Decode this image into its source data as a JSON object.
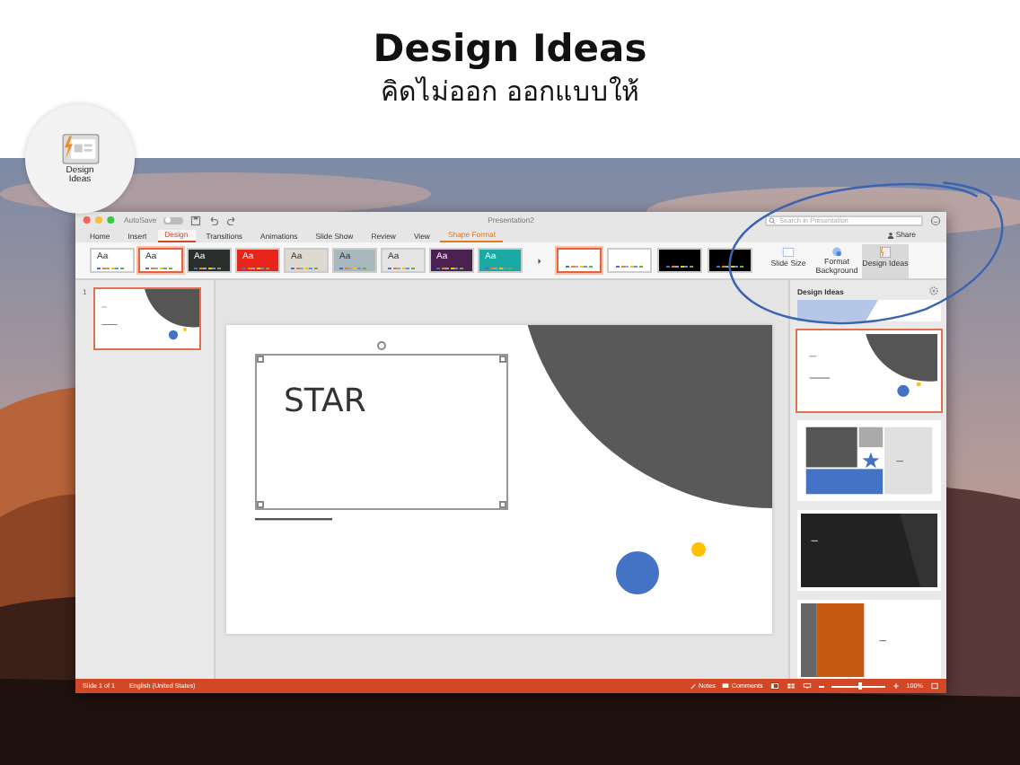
{
  "header": {
    "title": "Design Ideas",
    "subtitle": "คิดไม่ออก ออกแบบให้"
  },
  "badge": {
    "label": "Design Ideas"
  },
  "window": {
    "title": "Presentation2",
    "autosave": "AutoSave",
    "autosave_on": false,
    "search": {
      "placeholder": "Search in Presentation"
    }
  },
  "tabs": [
    {
      "label": "Home",
      "selected": false,
      "kind": "standard"
    },
    {
      "label": "Insert",
      "selected": false,
      "kind": "standard"
    },
    {
      "label": "Design",
      "selected": true,
      "kind": "standard"
    },
    {
      "label": "Transitions",
      "selected": false,
      "kind": "standard"
    },
    {
      "label": "Animations",
      "selected": false,
      "kind": "standard"
    },
    {
      "label": "Slide Show",
      "selected": false,
      "kind": "standard"
    },
    {
      "label": "Review",
      "selected": false,
      "kind": "standard"
    },
    {
      "label": "View",
      "selected": false,
      "kind": "standard"
    },
    {
      "label": "Shape Format",
      "selected": false,
      "kind": "contextual"
    }
  ],
  "share": "Share",
  "themes": [
    {
      "label": "Aa",
      "color": "#ffffff",
      "selected": false
    },
    {
      "label": "Aa",
      "color": "#ffffff",
      "selected": true
    },
    {
      "label": "Aa",
      "color": "#2b2f2c",
      "selected": false
    },
    {
      "label": "Aa",
      "color": "#e8251b",
      "selected": false
    },
    {
      "label": "Aa",
      "color": "#dedad2",
      "selected": false
    },
    {
      "label": "Aa",
      "color": "#a9b8bf",
      "selected": false
    },
    {
      "label": "Aa",
      "color": "#e4e4e4",
      "selected": false
    },
    {
      "label": "Aa",
      "color": "#4a2150",
      "selected": false
    },
    {
      "label": "Aa",
      "color": "#1aa9a3",
      "selected": false
    }
  ],
  "variants": [
    {
      "color": "#ffffff",
      "selected": true
    },
    {
      "color": "#ffffff",
      "selected": false
    },
    {
      "color": "#000000",
      "selected": false
    },
    {
      "color": "#000000",
      "selected": false
    }
  ],
  "ribbon_buttons": [
    {
      "label": "Slide Size",
      "kind": "size",
      "selected": false
    },
    {
      "label": "Format Background",
      "kind": "background",
      "selected": false
    },
    {
      "label": "Design Ideas",
      "kind": "ideas",
      "selected": true
    }
  ],
  "slides_panel": {
    "number": "1"
  },
  "slide": {
    "text": "STAR"
  },
  "design_ideas": {
    "title": "Design Ideas",
    "ideas": [
      {
        "kind": "partial",
        "selected": false
      },
      {
        "kind": "circles",
        "selected": true
      },
      {
        "kind": "blocks",
        "selected": false
      },
      {
        "kind": "dark",
        "selected": false
      },
      {
        "kind": "orange",
        "selected": false
      }
    ]
  },
  "status_bar": {
    "slide": "Slide 1 of 1",
    "language": "English (United States)",
    "notes": "Notes",
    "comments": "Comments",
    "zoom": "100%",
    "zoom_slider": {
      "level": 0.55
    }
  }
}
